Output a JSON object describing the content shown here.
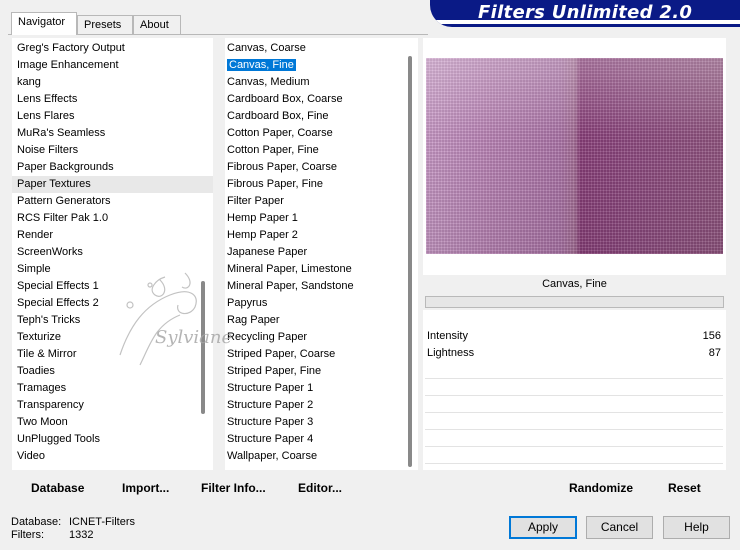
{
  "banner": {
    "title": "Filters Unlimited 2.0"
  },
  "tabs": [
    {
      "label": "Navigator",
      "active": true
    },
    {
      "label": "Presets",
      "active": false
    },
    {
      "label": "About",
      "active": false
    }
  ],
  "categories": [
    "Greg's Factory Output",
    "Image Enhancement",
    "kang",
    "Lens Effects",
    "Lens Flares",
    "MuRa's Seamless",
    "Noise Filters",
    "Paper Backgrounds",
    "Paper Textures",
    "Pattern Generators",
    "RCS Filter Pak 1.0",
    "Render",
    "ScreenWorks",
    "Simple",
    "Special Effects 1",
    "Special Effects 2",
    "Teph's Tricks",
    "Texturize",
    "Tile & Mirror",
    "Toadies",
    "Tramages",
    "Transparency",
    "Two Moon",
    "UnPlugged Tools",
    "Video"
  ],
  "selected_category": "Paper Textures",
  "filters": [
    "Canvas, Coarse",
    "Canvas, Fine",
    "Canvas, Medium",
    "Cardboard Box, Coarse",
    "Cardboard Box, Fine",
    "Cotton Paper, Coarse",
    "Cotton Paper, Fine",
    "Fibrous Paper, Coarse",
    "Fibrous Paper, Fine",
    "Filter Paper",
    "Hemp Paper 1",
    "Hemp Paper 2",
    "Japanese Paper",
    "Mineral Paper, Limestone",
    "Mineral Paper, Sandstone",
    "Papyrus",
    "Rag Paper",
    "Recycling Paper",
    "Striped Paper, Coarse",
    "Striped Paper, Fine",
    "Structure Paper 1",
    "Structure Paper 2",
    "Structure Paper 3",
    "Structure Paper 4",
    "Wallpaper, Coarse"
  ],
  "selected_filter": "Canvas, Fine",
  "filter_name_display": "Canvas, Fine",
  "params": [
    {
      "name": "Intensity",
      "value": "156"
    },
    {
      "name": "Lightness",
      "value": "87"
    }
  ],
  "watermark_text": "Sylviane",
  "bottom_links": {
    "database": "Database",
    "import": "Import...",
    "filter_info": "Filter Info...",
    "editor": "Editor...",
    "randomize": "Randomize",
    "reset": "Reset"
  },
  "status": {
    "database_label": "Database:",
    "database_value": "ICNET-Filters",
    "filters_label": "Filters:",
    "filters_value": "1332"
  },
  "buttons": {
    "apply": "Apply",
    "cancel": "Cancel",
    "help": "Help"
  },
  "colors": {
    "banner": "#0a1a86",
    "selection": "#0078d7"
  }
}
